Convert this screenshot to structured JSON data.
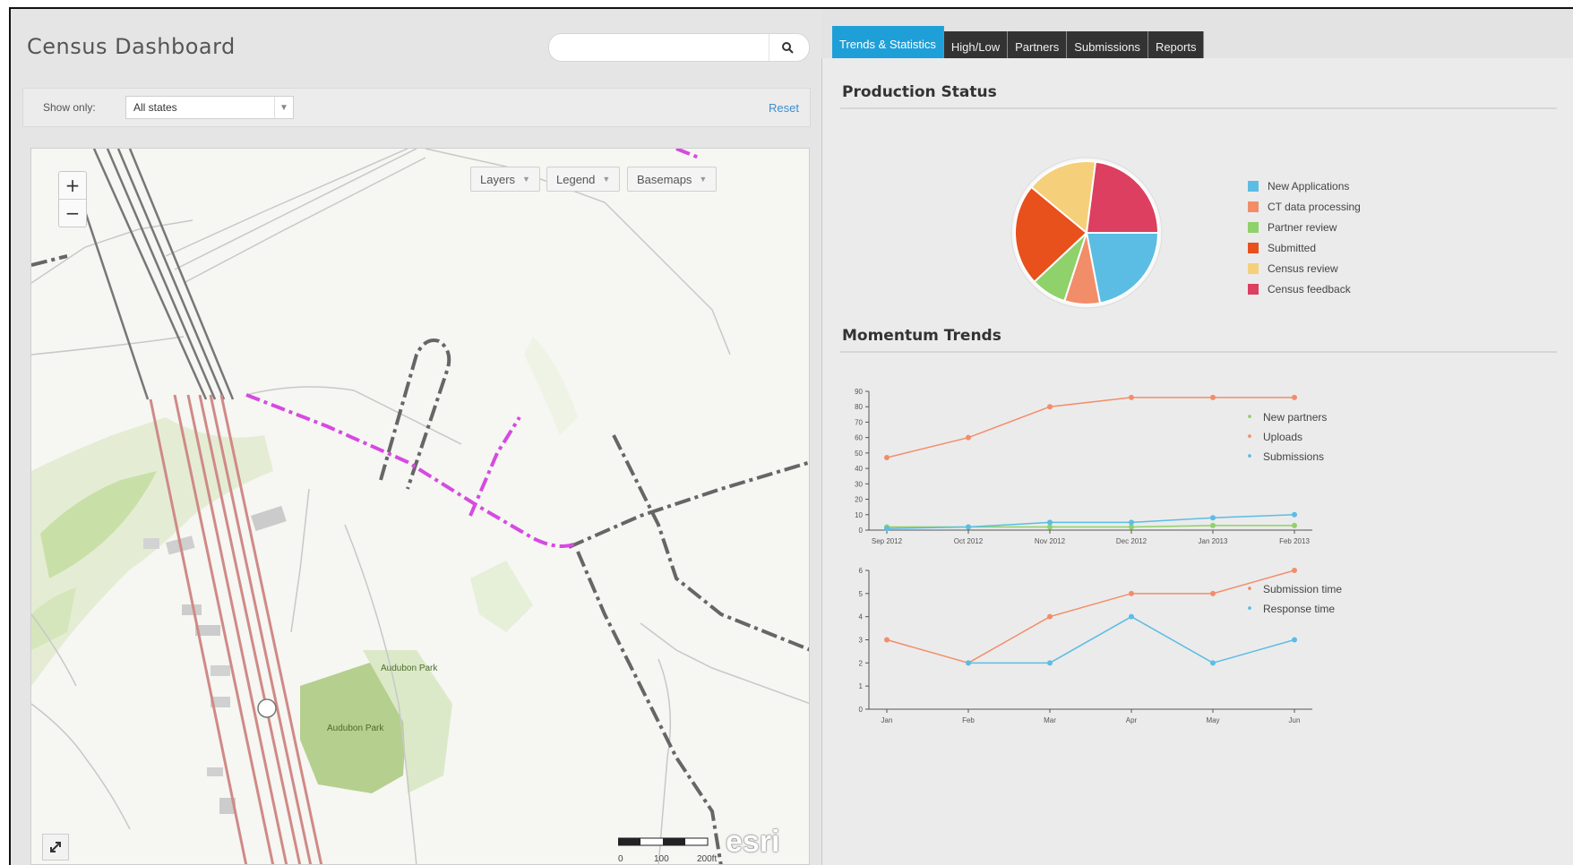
{
  "app": {
    "title": "Census Dashboard",
    "search": {
      "placeholder": "",
      "value": ""
    },
    "filter": {
      "label": "Show only:",
      "selected": "All states",
      "reset_label": "Reset"
    }
  },
  "map": {
    "buttons": {
      "layers": "Layers",
      "legend": "Legend",
      "basemaps": "Basemaps"
    },
    "zoom": {
      "in": "+",
      "out": "−"
    },
    "park_labels": [
      "Audubon Park",
      "Audubon Park"
    ],
    "scale_labels": [
      "0",
      "100",
      "200ft"
    ],
    "logo": "esri"
  },
  "tabs": [
    {
      "label": "Trends & Statistics",
      "active": true
    },
    {
      "label": "High/Low",
      "active": false
    },
    {
      "label": "Partners",
      "active": false
    },
    {
      "label": "Submissions",
      "active": false
    },
    {
      "label": "Reports",
      "active": false
    }
  ],
  "sections": {
    "production": "Production Status",
    "momentum": "Momentum Trends"
  },
  "chart_data": [
    {
      "type": "pie",
      "title": "Production Status",
      "categories": [
        "New Applications",
        "CT data processing",
        "Partner review",
        "Submitted",
        "Census review",
        "Census feedback"
      ],
      "values": [
        22,
        8,
        8,
        23,
        16,
        23
      ],
      "colors": [
        "#5bbde3",
        "#f28d6a",
        "#8fd16a",
        "#e8501c",
        "#f5cf7a",
        "#dc3f5f"
      ],
      "legend": "right"
    },
    {
      "type": "line",
      "categories": [
        "Sep 2012",
        "Oct 2012",
        "Nov 2012",
        "Dec 2012",
        "Jan 2013",
        "Feb 2013"
      ],
      "ylim": [
        0,
        90
      ],
      "yticks": [
        0,
        10,
        20,
        30,
        40,
        50,
        60,
        70,
        80,
        90
      ],
      "series": [
        {
          "name": "New partners",
          "values": [
            2,
            2,
            2,
            2,
            3,
            3
          ],
          "color": "#8fd16a"
        },
        {
          "name": "Uploads",
          "values": [
            47,
            60,
            80,
            86,
            86,
            86
          ],
          "color": "#f28d6a"
        },
        {
          "name": "Submissions",
          "values": [
            1,
            2,
            5,
            5,
            8,
            10
          ],
          "color": "#5bbde3"
        }
      ],
      "legend": "right"
    },
    {
      "type": "line",
      "categories": [
        "Jan",
        "Feb",
        "Mar",
        "Apr",
        "May",
        "Jun"
      ],
      "ylim": [
        0,
        6
      ],
      "yticks": [
        0,
        1,
        2,
        3,
        4,
        5,
        6
      ],
      "series": [
        {
          "name": "Submission time",
          "values": [
            3,
            2,
            4,
            5,
            5,
            6
          ],
          "color": "#f28d6a"
        },
        {
          "name": "Response time",
          "values": [
            null,
            2,
            2,
            4,
            2,
            3
          ],
          "color": "#5bbde3"
        }
      ],
      "legend": "right"
    }
  ]
}
